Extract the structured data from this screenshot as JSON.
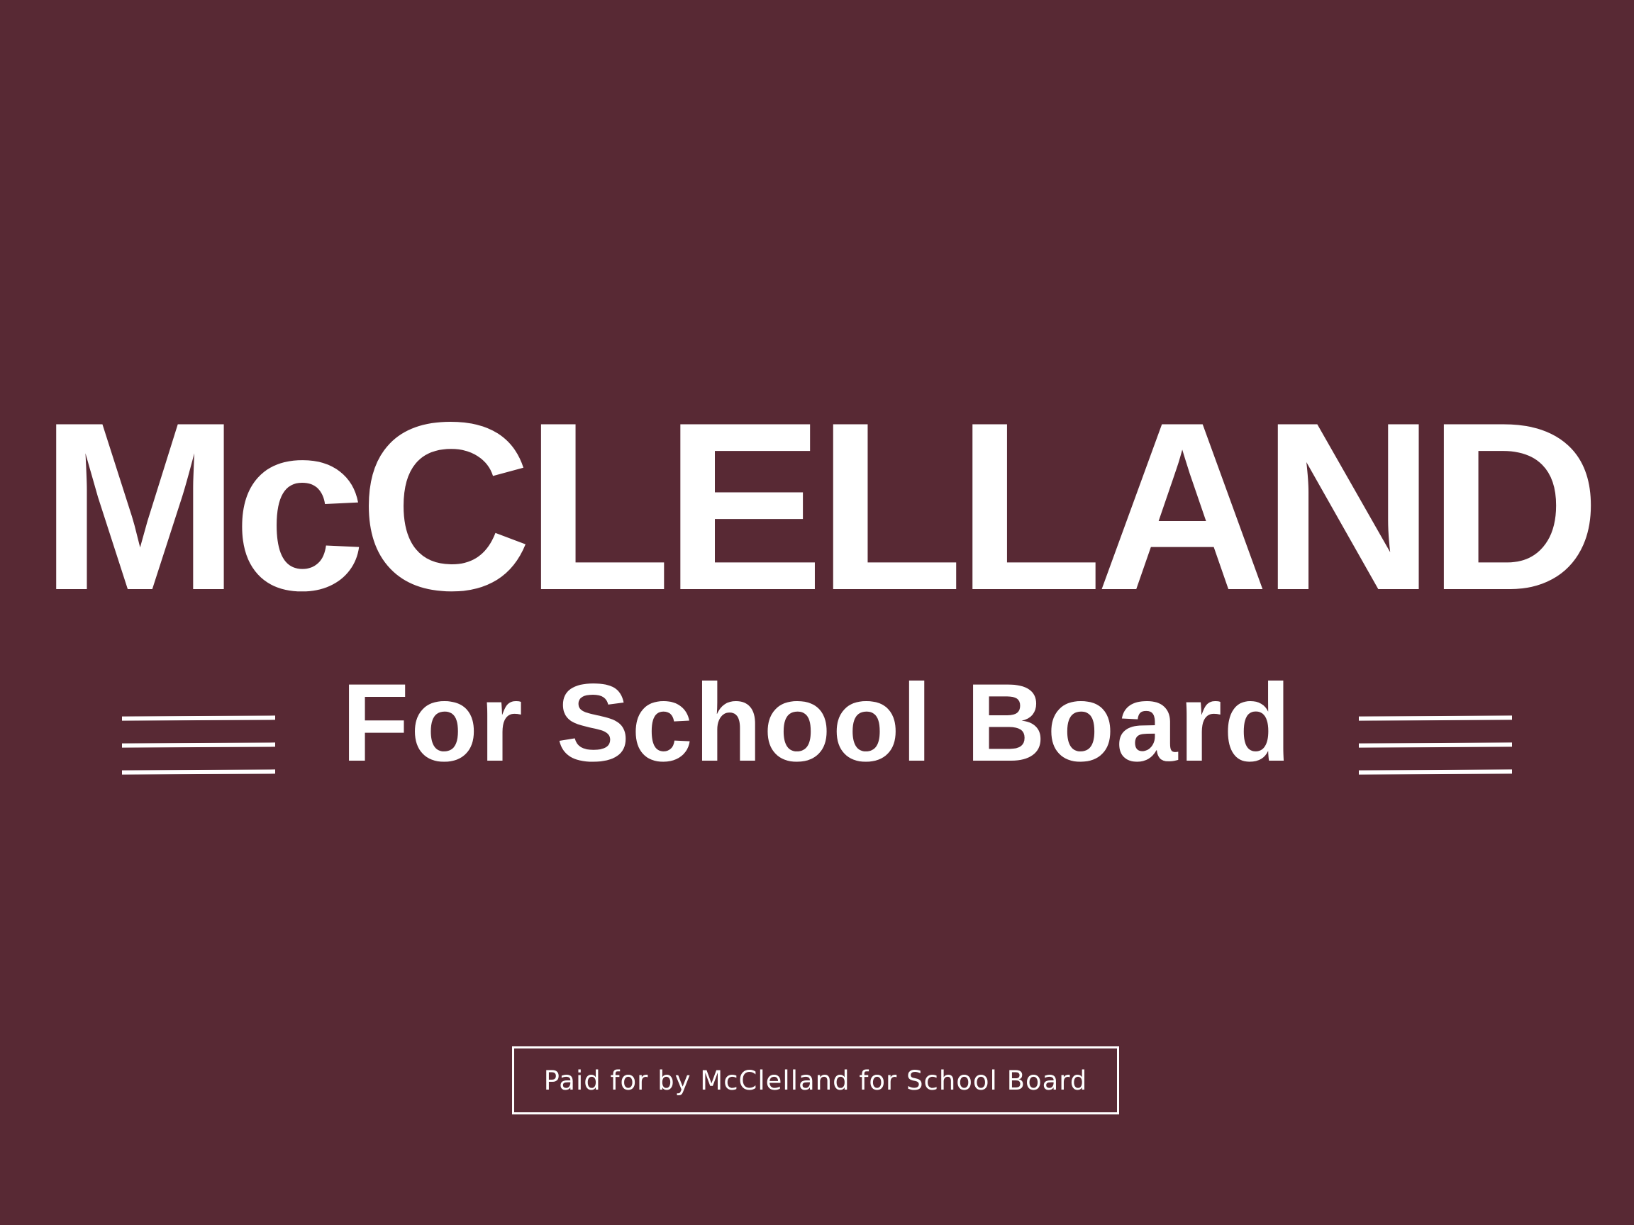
{
  "sign": {
    "background_color": "#582934",
    "text_color": "#ffffff",
    "candidate_name": "McCLELLAND",
    "subtitle": "For School Board",
    "disclaimer": "Paid for by McClelland for School Board"
  }
}
